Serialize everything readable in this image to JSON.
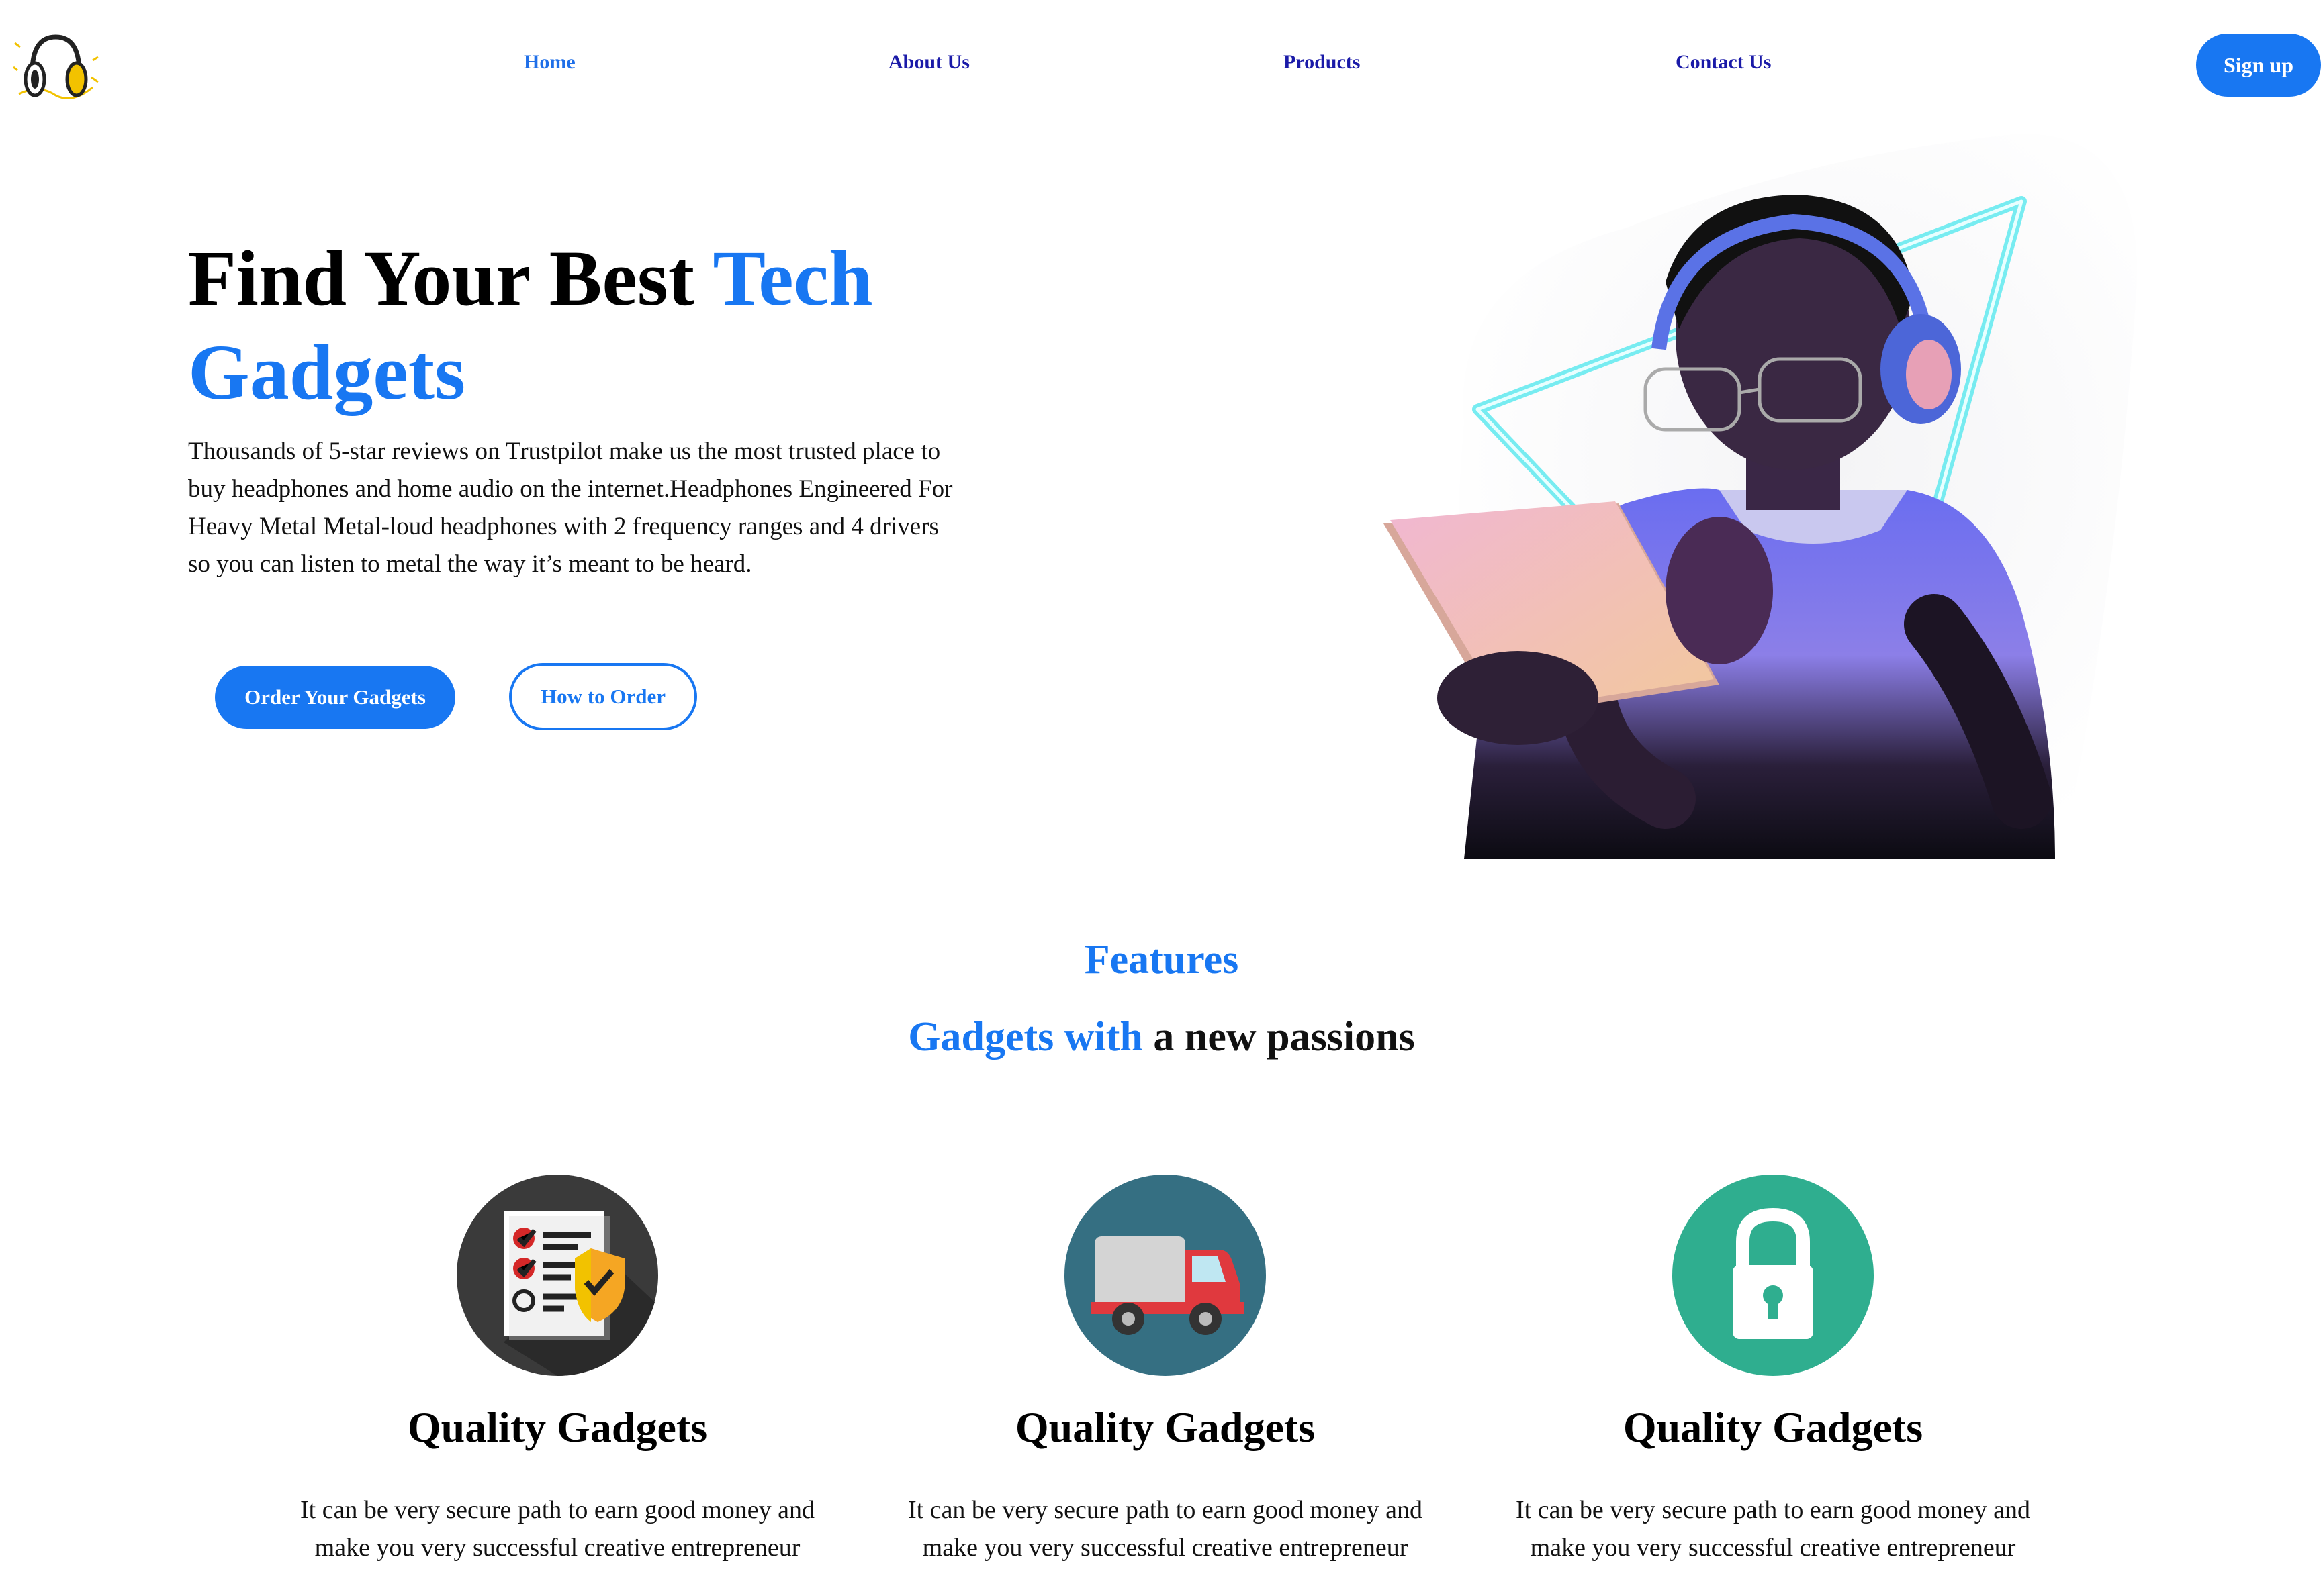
{
  "nav": {
    "items": [
      {
        "label": "Home"
      },
      {
        "label": "About Us"
      },
      {
        "label": "Products"
      },
      {
        "label": "Contact Us"
      }
    ],
    "signup_label": "Sign up"
  },
  "hero": {
    "title_part1": "Find Your Best ",
    "title_part2": "Tech",
    "title_part3": "Gadgets",
    "description": "Thousands of 5-star reviews on Trustpilot make us the most trusted place to buy headphones and home audio on the internet.Headphones Engineered For Heavy Metal Metal-loud headphones with 2 frequency ranges and 4 drivers so you can listen to metal the way it’s meant to be heard.",
    "order_button": "Order Your Gadgets",
    "how_button": "How to Order"
  },
  "features": {
    "label": "Features",
    "subtitle_blue": "Gadgets with",
    "subtitle_rest": " a new passions",
    "cards": [
      {
        "icon": "checklist-shield-icon",
        "title": "Quality Gadgets",
        "text": "It can be very secure path to earn good money and make you very successful creative entrepreneur"
      },
      {
        "icon": "delivery-truck-icon",
        "title": "Quality Gadgets",
        "text": "It can be very secure path to earn good money and make you very successful creative entrepreneur"
      },
      {
        "icon": "padlock-icon",
        "title": "Quality Gadgets",
        "text": "It can be very secure path to earn good money and make you very successful creative entrepreneur"
      }
    ]
  },
  "colors": {
    "accent": "#1877f2",
    "nav_link": "#1a1aa8",
    "icon_dark": "#3a3a3a",
    "icon_teal_dark": "#356f82",
    "icon_green": "#2fae8f"
  }
}
